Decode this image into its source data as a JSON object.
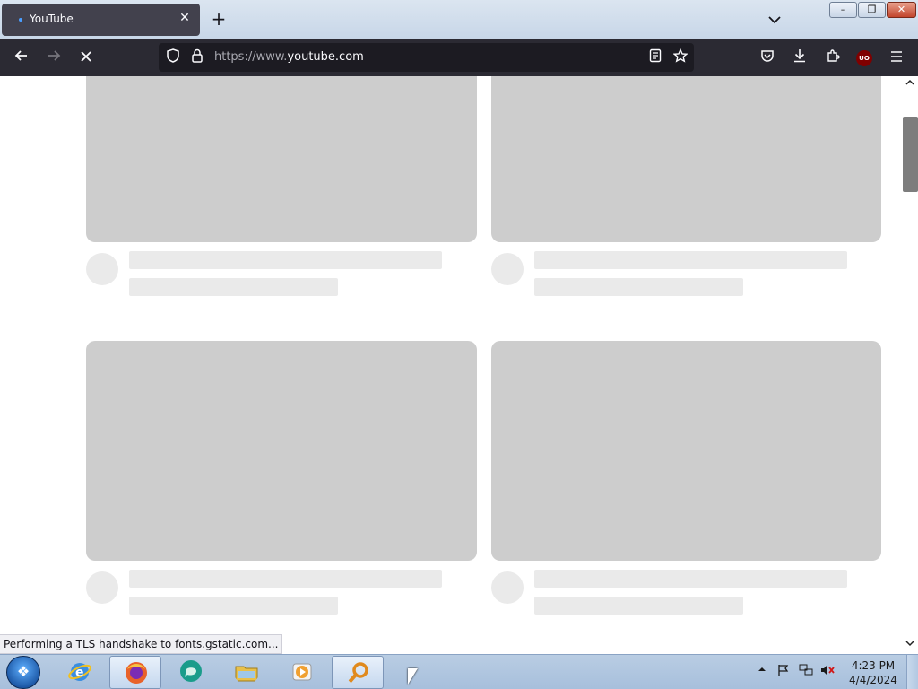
{
  "browser": {
    "tab": {
      "title": "YouTube"
    },
    "new_tab_symbol": "+",
    "url": {
      "scheme": "https://www.",
      "host": "youtube.com"
    },
    "icons": {
      "back": "arrow-left-icon",
      "forward": "arrow-right-icon",
      "stop": "stop-x-icon",
      "shield": "shield-icon",
      "lock": "lock-icon",
      "reader": "reader-view-icon",
      "bookmark": "star-icon",
      "pocket": "pocket-icon",
      "downloads": "download-icon",
      "extensions": "puzzle-icon",
      "ublock": "ublock-origin-icon",
      "menu": "hamburger-menu-icon"
    },
    "ublock_badge": "UO",
    "status_text": "Performing a TLS handshake to fonts.gstatic.com..."
  },
  "window_controls": {
    "minimize": "–",
    "maximize": "❐",
    "close": "✕"
  },
  "page": {
    "placeholders": [
      {
        "state": "loading"
      },
      {
        "state": "loading"
      },
      {
        "state": "loading"
      },
      {
        "state": "loading"
      }
    ]
  },
  "taskbar": {
    "start_label": "❖",
    "apps": [
      {
        "name": "Internet Explorer",
        "icon": "internet-explorer-icon",
        "color": "#3b8ee0"
      },
      {
        "name": "Firefox",
        "icon": "firefox-icon",
        "color": "#e8622a",
        "active": true
      },
      {
        "name": "Chat",
        "icon": "chat-bubble-icon",
        "color": "#1a9c8a"
      },
      {
        "name": "Windows Explorer",
        "icon": "folder-icon",
        "color": "#e8c04a"
      },
      {
        "name": "Media Player",
        "icon": "media-player-icon",
        "color": "#f0a030"
      },
      {
        "name": "Search",
        "icon": "magnifier-icon",
        "color": "#e08a1e",
        "active": true
      }
    ],
    "clock": {
      "time": "4:23 PM",
      "date": "4/4/2024"
    }
  }
}
